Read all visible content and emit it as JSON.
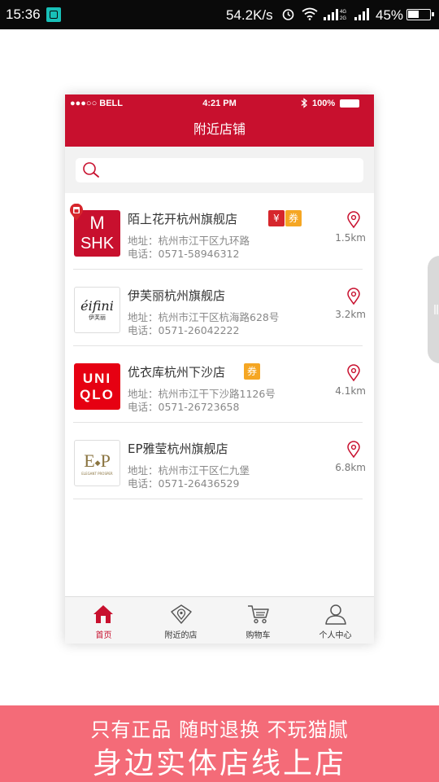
{
  "android_status": {
    "time": "15:36",
    "net_speed": "54.2K/s",
    "battery": "45%"
  },
  "phone": {
    "ios_status": {
      "carrier": "●●●○○ BELL",
      "time": "4:21 PM",
      "battery": "100%"
    },
    "title": "附近店铺",
    "search": {
      "placeholder": ""
    },
    "stores": [
      {
        "name": "陌上花开杭州旗舰店",
        "address": "地址：杭州市江干区九环路",
        "phone": "电话：0571-58946312",
        "distance": "1.5km",
        "logo_text": [
          "M",
          "SHK"
        ],
        "badges": [
          "¥",
          "券"
        ]
      },
      {
        "name": "伊芙丽杭州旗舰店",
        "address": "地址：杭州市江干区杭海路628号",
        "phone": "电话：0571-26042222",
        "distance": "3.2km",
        "logo_text": [
          "éifini",
          "伊芙丽"
        ]
      },
      {
        "name": "优衣库杭州下沙店",
        "address": "地址：杭州市江干下沙路1126号",
        "phone": "电话：0571-26723658",
        "distance": "4.1km",
        "logo_text": [
          "UNI",
          "QLO"
        ],
        "badges": [
          "券"
        ]
      },
      {
        "name": "EP雅莹杭州旗舰店",
        "address": "地址：杭州市江干区仁九堡",
        "phone": "电话：0571-26436529",
        "distance": "6.8km",
        "logo_text": [
          "E",
          "P",
          "ELEGANT PROSPER"
        ]
      }
    ],
    "tabs": [
      {
        "label": "首页",
        "icon": "home-icon",
        "active": true
      },
      {
        "label": "附近的店",
        "icon": "location-icon",
        "active": false
      },
      {
        "label": "购物车",
        "icon": "cart-icon",
        "active": false
      },
      {
        "label": "个人中心",
        "icon": "user-icon",
        "active": false
      }
    ]
  },
  "promo": {
    "line1": "只有正品  随时退换 不玩猫腻",
    "line2": "身边实体店线上店"
  },
  "colors": {
    "brand_red": "#c8102e",
    "promo_pink": "#f46b78",
    "coupon_orange": "#f5a623"
  }
}
